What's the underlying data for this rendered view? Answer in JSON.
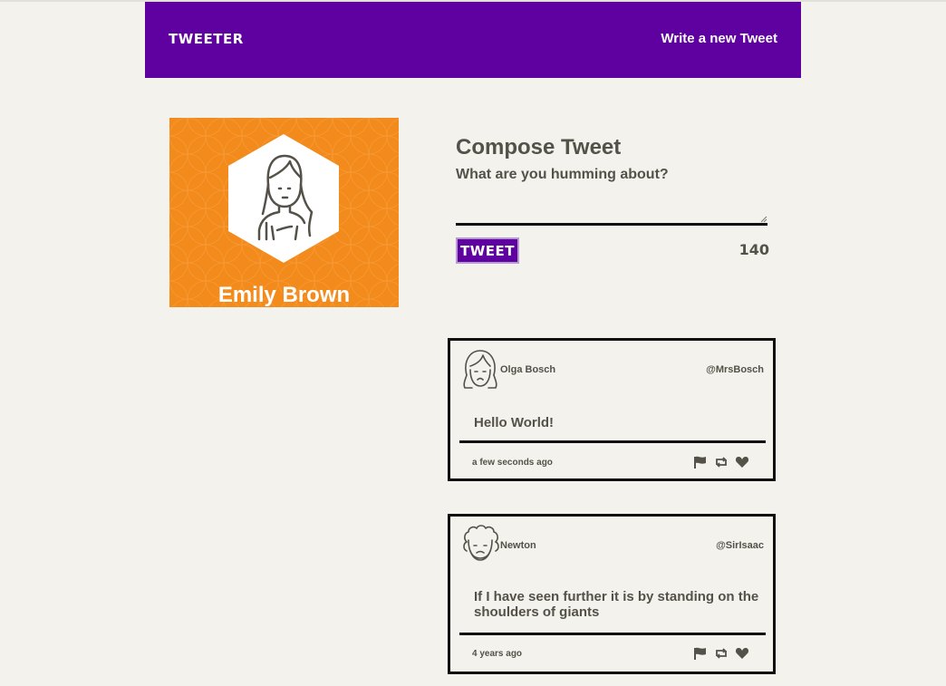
{
  "nav": {
    "brand": "TWEETER",
    "write_link": "Write a new Tweet",
    "color": "#5f00a0"
  },
  "profile": {
    "name": "Emily Brown",
    "background_color": "#f38b1c"
  },
  "compose": {
    "title": "Compose Tweet",
    "prompt": "What are you humming about?",
    "input_value": "",
    "button_label": "TWEET",
    "counter": "140"
  },
  "tweets": [
    {
      "name": "Olga Bosch",
      "handle": "@MrsBosch",
      "content": "Hello World!",
      "time": "a few seconds ago",
      "avatar_icon": "woman-face-icon"
    },
    {
      "name": "Newton",
      "handle": "@SirIsaac",
      "content": "If I have seen further it is by standing on the shoulders of giants",
      "time": "4 years ago",
      "avatar_icon": "curly-hair-man-face-icon"
    }
  ]
}
